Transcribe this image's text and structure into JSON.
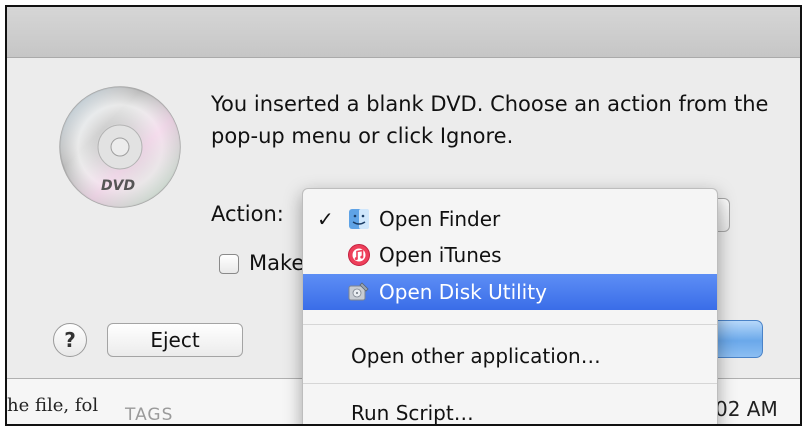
{
  "dialog": {
    "message": "You inserted a blank DVD. Choose an action from the pop-up menu or click Ignore.",
    "action_label": "Action:",
    "checkbox_label": "Make",
    "checkbox_checked": false,
    "help_label": "?",
    "eject_label": "Eject",
    "dvd_icon": "dvd-disc-icon",
    "dvd_icon_text": "DVD"
  },
  "menu": {
    "selected_item": "Open Finder",
    "items": [
      {
        "label": "Open Finder",
        "checked": true,
        "icon": "finder-icon"
      },
      {
        "label": "Open iTunes",
        "checked": false,
        "icon": "itunes-icon"
      },
      {
        "label": "Open Disk Utility",
        "checked": false,
        "icon": "disk-utility-icon",
        "highlighted": true
      },
      {
        "label": "Open other application…"
      },
      {
        "label": "Run Script…"
      }
    ],
    "check_glyph": "✓",
    "highlight_color": "#3f73ea"
  },
  "background_window": {
    "file_text": "he file, fol",
    "tags_label": "TAGS",
    "time_text": "02 AM"
  }
}
